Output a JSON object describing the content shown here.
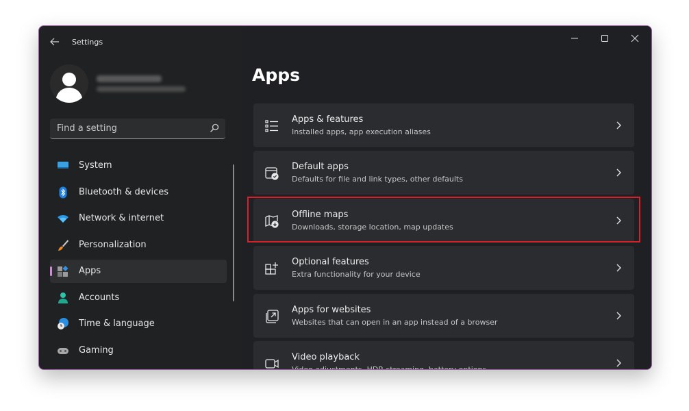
{
  "window": {
    "title": "Settings",
    "controls": {
      "minimize": "minimize-icon",
      "maximize": "maximize-icon",
      "close": "close-icon"
    }
  },
  "user": {
    "name": "(blurred)",
    "email": "(blurred)"
  },
  "search": {
    "placeholder": "Find a setting"
  },
  "sidebar": {
    "items": [
      {
        "label": "System",
        "icon": "monitor-icon",
        "active": false
      },
      {
        "label": "Bluetooth & devices",
        "icon": "bluetooth-icon",
        "active": false
      },
      {
        "label": "Network & internet",
        "icon": "wifi-icon",
        "active": false
      },
      {
        "label": "Personalization",
        "icon": "brush-icon",
        "active": false
      },
      {
        "label": "Apps",
        "icon": "apps-icon",
        "active": true
      },
      {
        "label": "Accounts",
        "icon": "person-icon",
        "active": false
      },
      {
        "label": "Time & language",
        "icon": "globe-clock-icon",
        "active": false
      },
      {
        "label": "Gaming",
        "icon": "gamepad-icon",
        "active": false
      }
    ]
  },
  "main": {
    "title": "Apps",
    "cards": [
      {
        "title": "Apps & features",
        "subtitle": "Installed apps, app execution aliases",
        "icon": "list-icon"
      },
      {
        "title": "Default apps",
        "subtitle": "Defaults for file and link types, other defaults",
        "icon": "default-apps-icon"
      },
      {
        "title": "Offline maps",
        "subtitle": "Downloads, storage location, map updates",
        "icon": "map-download-icon",
        "highlighted": true
      },
      {
        "title": "Optional features",
        "subtitle": "Extra functionality for your device",
        "icon": "grid-plus-icon"
      },
      {
        "title": "Apps for websites",
        "subtitle": "Websites that can open in an app instead of a browser",
        "icon": "open-external-icon"
      },
      {
        "title": "Video playback",
        "subtitle": "Video adjustments, HDR streaming, battery options",
        "icon": "video-camera-icon"
      }
    ]
  },
  "colors": {
    "accent": "#d08ad8",
    "highlight": "#d8202a",
    "window_border": "#9a5aa8"
  }
}
